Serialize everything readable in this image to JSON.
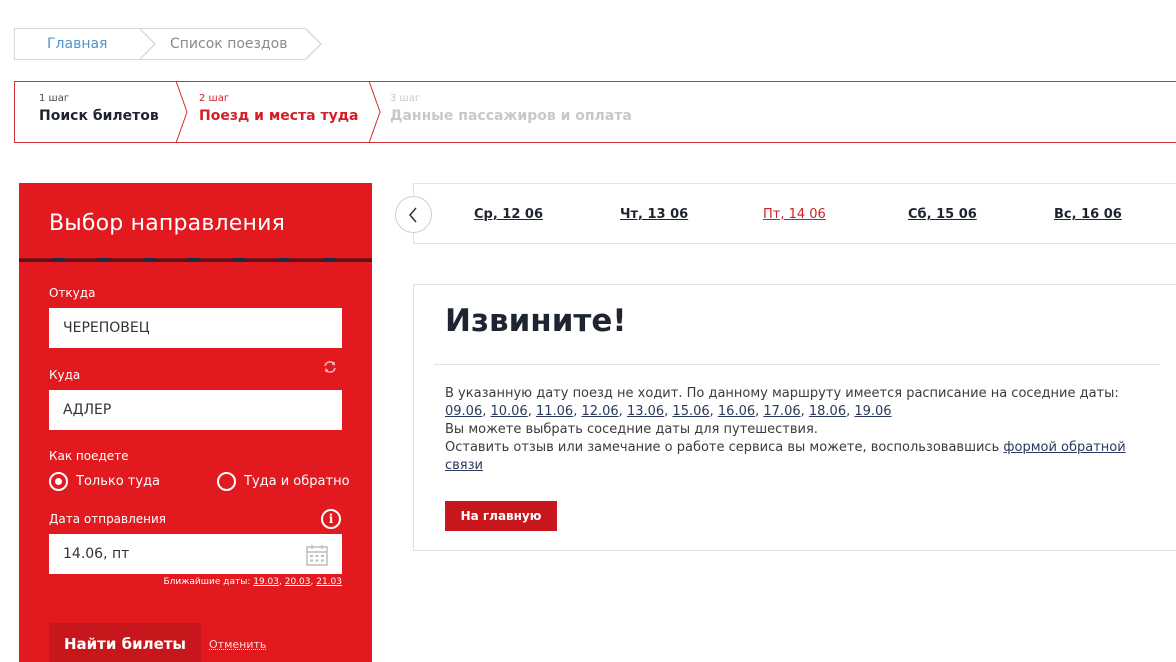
{
  "breadcrumb": {
    "home": "Главная",
    "current": "Список поездов"
  },
  "steps": [
    {
      "num": "1 шаг",
      "title": "Поиск билетов"
    },
    {
      "num": "2 шаг",
      "title": "Поезд и места туда"
    },
    {
      "num": "3 шаг",
      "title": "Данные пассажиров и оплата"
    }
  ],
  "panel": {
    "title": "Выбор направления",
    "from_label": "Откуда",
    "from_value": "ЧЕРЕПОВЕЦ",
    "to_label": "Куда",
    "to_value": "АДЛЕР",
    "trip_label": "Как поедете",
    "trip_one_way": "Только туда",
    "trip_round": "Туда и обратно",
    "date_label": "Дата отправления",
    "date_value": "14.06, пт",
    "nearest_label": "Ближайшие даты:",
    "nearest_dates": [
      "19.03",
      "20.03",
      "21.03"
    ],
    "find_button": "Найти билеты",
    "cancel_link": "Отменить"
  },
  "datebar": {
    "dates": [
      "Ср, 12 06",
      "Чт, 13 06",
      "Пт, 14 06",
      "Сб, 15 06",
      "Вс, 16 06"
    ],
    "active_index": 2
  },
  "message": {
    "title": "Извините!",
    "text1": "В указанную дату поезд не ходит. По данному маршруту имеется расписание на соседние даты:",
    "alt_dates": [
      "09.06",
      "10.06",
      "11.06",
      "12.06",
      "13.06",
      "15.06",
      "16.06",
      "17.06",
      "18.06",
      "19.06"
    ],
    "text2": "Вы можете выбрать соседние даты для путешествия.",
    "text3": "Оставить отзыв или замечание о работе сервиса вы можете, воспользовавшись",
    "feedback_link": "формой обратной связи",
    "home_button": "На главную"
  },
  "colors": {
    "brand_red": "#e21a1f",
    "button_red": "#c7171c",
    "active_date": "#d12025",
    "link_blue": "#4f95d0"
  }
}
